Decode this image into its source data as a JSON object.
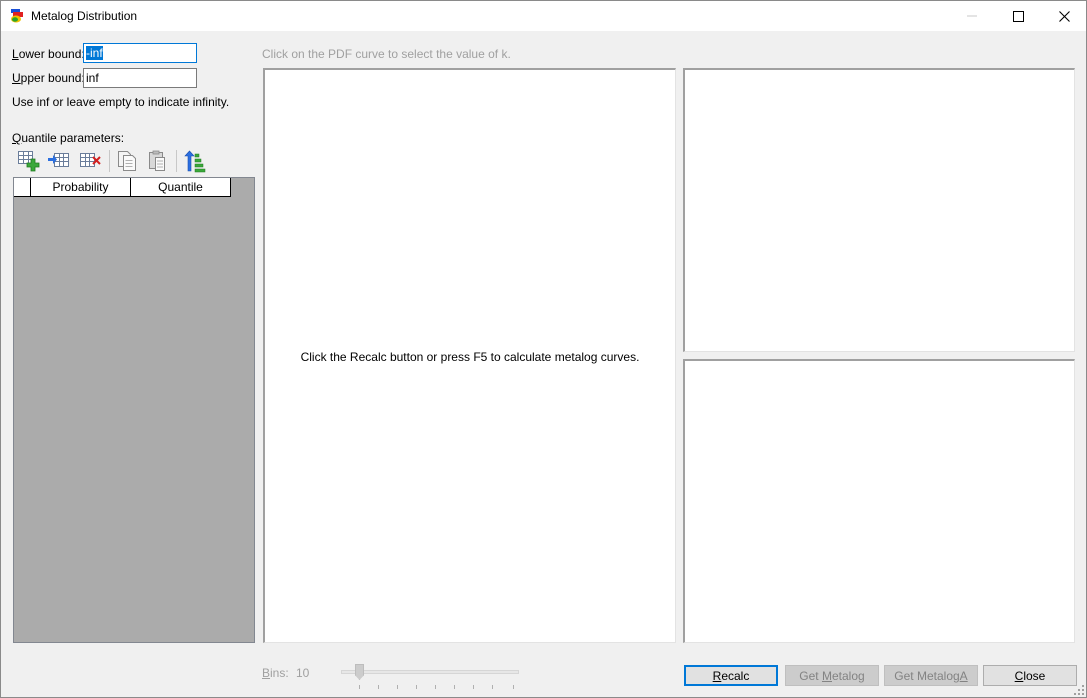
{
  "window": {
    "title": "Metalog Distribution",
    "app_icon": "metalog-app-icon",
    "controls": {
      "minimize": "minimize-icon",
      "maximize": "maximize-icon",
      "close": "close-icon"
    }
  },
  "bounds": {
    "lower_label": "Lower bound:",
    "lower_value": "-inf",
    "upper_label": "Upper bound:",
    "upper_value": "inf",
    "hint": "Use inf or leave empty to indicate infinity."
  },
  "quantile": {
    "label": "Quantile parameters:",
    "toolbar": [
      {
        "icon": "add-row-icon"
      },
      {
        "icon": "insert-row-icon"
      },
      {
        "icon": "delete-row-icon"
      },
      {
        "icon": "copy-icon"
      },
      {
        "icon": "paste-icon"
      },
      {
        "icon": "sort-ascending-icon"
      }
    ],
    "columns": [
      "Probability",
      "Quantile"
    ]
  },
  "pdf_hint": "Click on the PDF curve to select the value of k.",
  "main_message": "Click the Recalc button or press F5 to calculate metalog curves.",
  "bins": {
    "label": "Bins:",
    "value": "10"
  },
  "buttons": {
    "recalc": "Recalc",
    "get_metalog": "Get Metalog",
    "get_metaloga": "Get MetalogA",
    "close": "Close"
  }
}
